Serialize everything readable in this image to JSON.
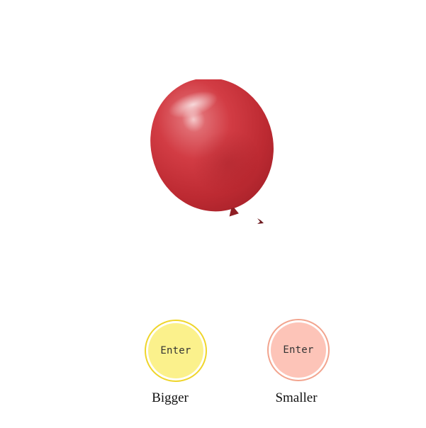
{
  "balloon": {
    "color": "#c8313a"
  },
  "controls": {
    "bigger": {
      "button_label": "Enter",
      "caption": "Bigger",
      "fill_color": "#fbf18c",
      "ring_color": "#efd52a"
    },
    "smaller": {
      "button_label": "Enter",
      "caption": "Smaller",
      "fill_color": "#fdc4b8",
      "ring_color": "#f2a48e"
    }
  }
}
